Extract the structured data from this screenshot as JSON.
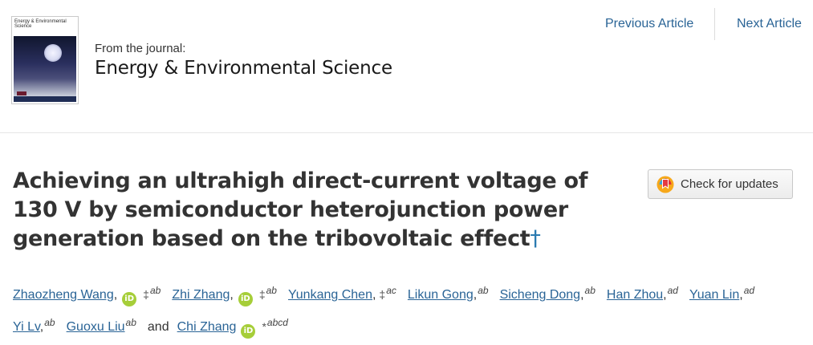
{
  "journal": {
    "cover_title": "Energy & Environmental Science",
    "from_label": "From the journal:",
    "name": "Energy & Environmental Science"
  },
  "nav": {
    "previous": "Previous Article",
    "next": "Next Article"
  },
  "article": {
    "title": "Achieving an ultrahigh direct-current voltage of 130 V by semiconductor heterojunction power generation based on the tribovoltaic effect",
    "title_dagger": "†"
  },
  "check_updates": {
    "label": "Check for updates",
    "icon": "crossmark-icon"
  },
  "authors": [
    {
      "name": "Zhaozheng Wang",
      "sep": ",",
      "orcid": true,
      "mark": "‡",
      "aff": "ab"
    },
    {
      "name": "Zhi Zhang",
      "sep": ",",
      "orcid": true,
      "mark": "‡",
      "aff": "ab"
    },
    {
      "name": "Yunkang Chen",
      "sep": ",",
      "orcid": false,
      "mark": "‡",
      "aff": "ac"
    },
    {
      "name": "Likun Gong",
      "sep": ",",
      "orcid": false,
      "mark": "",
      "aff": "ab"
    },
    {
      "name": "Sicheng Dong",
      "sep": ",",
      "orcid": false,
      "mark": "",
      "aff": "ab"
    },
    {
      "name": "Han Zhou",
      "sep": ",",
      "orcid": false,
      "mark": "",
      "aff": "ad"
    },
    {
      "name": "Yuan Lin",
      "sep": ",",
      "orcid": false,
      "mark": "",
      "aff": "ad"
    },
    {
      "name": "Yi Lv",
      "sep": ",",
      "orcid": false,
      "mark": "",
      "aff": "ab"
    },
    {
      "name": "Guoxu Liu",
      "sep": "",
      "orcid": false,
      "mark": "",
      "aff": "ab"
    },
    {
      "name": "Chi Zhang",
      "sep": "",
      "orcid": true,
      "mark": "*",
      "aff": "abcd"
    }
  ],
  "authors_conjunction": "and",
  "orcid_icon_label": "iD"
}
